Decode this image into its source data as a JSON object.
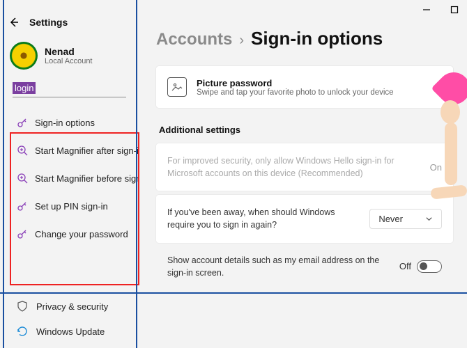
{
  "window": {
    "title": "Settings"
  },
  "account": {
    "name": "Nenad",
    "type": "Local Account"
  },
  "search": {
    "query": "login"
  },
  "search_results": [
    {
      "icon": "key",
      "label": "Sign-in options"
    },
    {
      "icon": "magnify",
      "label": "Start Magnifier after sign-in"
    },
    {
      "icon": "magnify",
      "label": "Start Magnifier before sign-in"
    },
    {
      "icon": "key",
      "label": "Set up PIN sign-in"
    },
    {
      "icon": "key",
      "label": "Change your password"
    }
  ],
  "sidebar_nav": [
    {
      "icon": "shield",
      "label": "Privacy & security"
    },
    {
      "icon": "update",
      "label": "Windows Update"
    }
  ],
  "breadcrumb": {
    "parent": "Accounts",
    "sep": "›",
    "current": "Sign-in options"
  },
  "picture_card": {
    "title": "Picture password",
    "sub": "Swipe and tap your favorite photo to unlock your device"
  },
  "additional_header": "Additional settings",
  "settings": {
    "hello": {
      "text": "For improved security, only allow Windows Hello sign-in for Microsoft accounts on this device (Recommended)",
      "value": "On"
    },
    "away": {
      "text": "If you've been away, when should Windows require you to sign in again?",
      "value": "Never"
    },
    "details": {
      "text": "Show account details such as my email address on the sign-in screen.",
      "value": "Off"
    }
  }
}
